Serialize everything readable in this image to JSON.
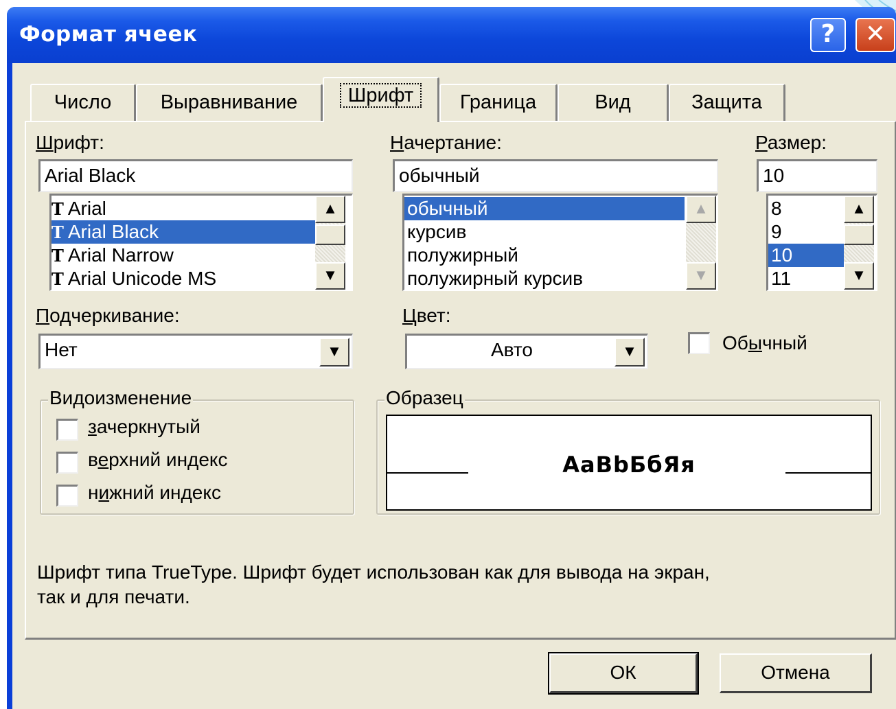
{
  "window": {
    "title": "Формат ячеек",
    "help_symbol": "?",
    "close_symbol": "✕"
  },
  "tabs": [
    {
      "label": "Число",
      "active": false
    },
    {
      "label": "Выравнивание",
      "active": false
    },
    {
      "label": "Шрифт",
      "active": true
    },
    {
      "label": "Граница",
      "active": false
    },
    {
      "label": "Вид",
      "active": false
    },
    {
      "label": "Защита",
      "active": false
    }
  ],
  "font": {
    "label_hotkey": "Ш",
    "label_rest": "рифт:",
    "value": "Arial Black",
    "items": [
      {
        "label": "Arial",
        "selected": false
      },
      {
        "label": "Arial Black",
        "selected": true
      },
      {
        "label": "Arial Narrow",
        "selected": false
      },
      {
        "label": "Arial Unicode MS",
        "selected": false
      }
    ],
    "item_icon": "truetype-icon",
    "icon_glyph": "T"
  },
  "style": {
    "label_hotkey": "Н",
    "label_rest": "ачертание:",
    "value": "обычный",
    "items": [
      {
        "label": "обычный",
        "selected": true
      },
      {
        "label": "курсив",
        "selected": false
      },
      {
        "label": "полужирный",
        "selected": false
      },
      {
        "label": "полужирный курсив",
        "selected": false
      }
    ]
  },
  "size": {
    "label_hotkey": "Р",
    "label_rest": "азмер:",
    "value": "10",
    "items": [
      {
        "label": "8",
        "selected": false
      },
      {
        "label": "9",
        "selected": false
      },
      {
        "label": "10",
        "selected": true
      },
      {
        "label": "11",
        "selected": false
      }
    ]
  },
  "underline": {
    "label_hotkey": "П",
    "label_rest": "одчеркивание:",
    "value": "Нет"
  },
  "color": {
    "label_hotkey": "Ц",
    "label_rest": "вет:",
    "value": "Авто"
  },
  "normal_font": {
    "label_pre": "Об",
    "label_hotkey": "ы",
    "label_post": "чный",
    "checked": false
  },
  "effects": {
    "title": "Видоизменение",
    "items": [
      {
        "pre": "",
        "hotkey": "з",
        "post": "ачеркнутый",
        "checked": false
      },
      {
        "pre": "в",
        "hotkey": "е",
        "post": "рхний индекс",
        "checked": false
      },
      {
        "pre": "н",
        "hotkey": "и",
        "post": "жний индекс",
        "checked": false
      }
    ]
  },
  "preview": {
    "title": "Образец",
    "sample_text": "АаВbБбЯя"
  },
  "hint": {
    "line1": "Шрифт типа TrueType. Шрифт будет использован как для вывода на экран,",
    "line2": "так и для печати."
  },
  "buttons": {
    "ok": "ОК",
    "cancel": "Отмена"
  },
  "icons": {
    "scroll_up": "▲",
    "scroll_down": "▼",
    "dropdown": "▼"
  },
  "colors": {
    "title_bar": "#0a3fd8",
    "dialog_bg": "#ece9d8",
    "selection": "#316ac5",
    "close_button": "#c8401b"
  }
}
